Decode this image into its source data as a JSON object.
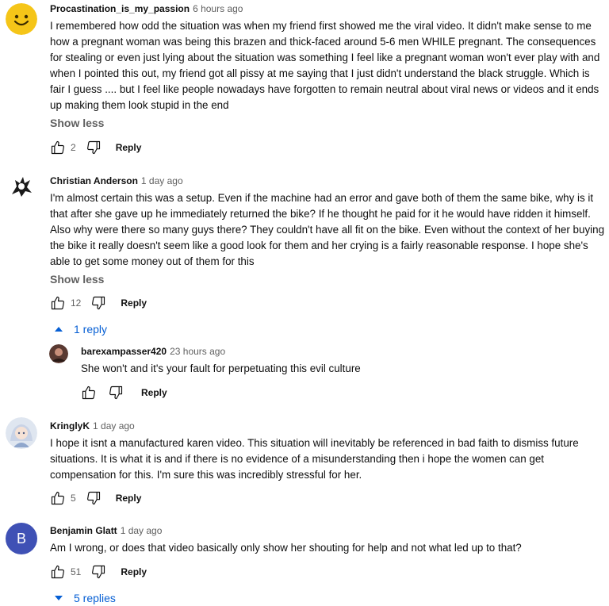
{
  "comments": [
    {
      "author": "Procastination_is_my_passion",
      "time": "6 hours ago",
      "text": "I remembered how odd the situation was when my friend first showed me the viral video. It didn't make sense to me how a pregnant woman was being this brazen and thick-faced around 5-6 men WHILE pregnant. The consequences for stealing or even just lying about the situation was something I feel like a pregnant woman won't ever play with and when I pointed this out, my friend got all pissy at me saying that I just didn't understand the black struggle. Which is fair I guess .... but I feel like people nowadays have forgotten to remain neutral about viral news or videos and it ends up making them look stupid in the end",
      "show_less": "Show less",
      "likes": "2",
      "reply": "Reply",
      "avatar_color": "#f5c518"
    },
    {
      "author": "Christian Anderson",
      "time": "1 day ago",
      "text": "I'm almost certain this was a setup. Even if the machine had an error and gave both of them the same bike, why is it that after she gave up he immediately returned the bike? If he thought he paid for it he would have ridden it himself. Also why were there so many guys there? They couldn't have all fit on the bike. Even without the context of her buying the bike it really doesn't seem like a good look for them and her crying is a fairly reasonable response. I hope she's able to get some money out of them for this",
      "show_less": "Show less",
      "likes": "12",
      "reply": "Reply",
      "replies_toggle": "1 reply"
    },
    {
      "author": "barexampasser420",
      "time": "23 hours ago",
      "text": "She won't and it's your fault for perpetuating this evil culture",
      "reply": "Reply"
    },
    {
      "author": "KringlyK",
      "time": "1 day ago",
      "text": "I hope it isnt a manufactured karen video. This situation will inevitably be referenced in bad faith to dismiss future situations. It is what it is and if there is no evidence of a misunderstanding then i hope the women can get compensation for this. I'm sure this was incredibly stressful for her.",
      "likes": "5",
      "reply": "Reply"
    },
    {
      "author": "Benjamin Glatt",
      "time": "1 day ago",
      "text": "Am I wrong, or does that video basically only show her shouting for help and not what led up to that?",
      "likes": "51",
      "reply": "Reply",
      "avatar_letter": "B",
      "avatar_color": "#3f51b5",
      "replies_toggle": "5 replies"
    }
  ],
  "colors": {
    "link_blue": "#065fd4",
    "meta_gray": "#606060",
    "text": "#0f0f0f"
  }
}
